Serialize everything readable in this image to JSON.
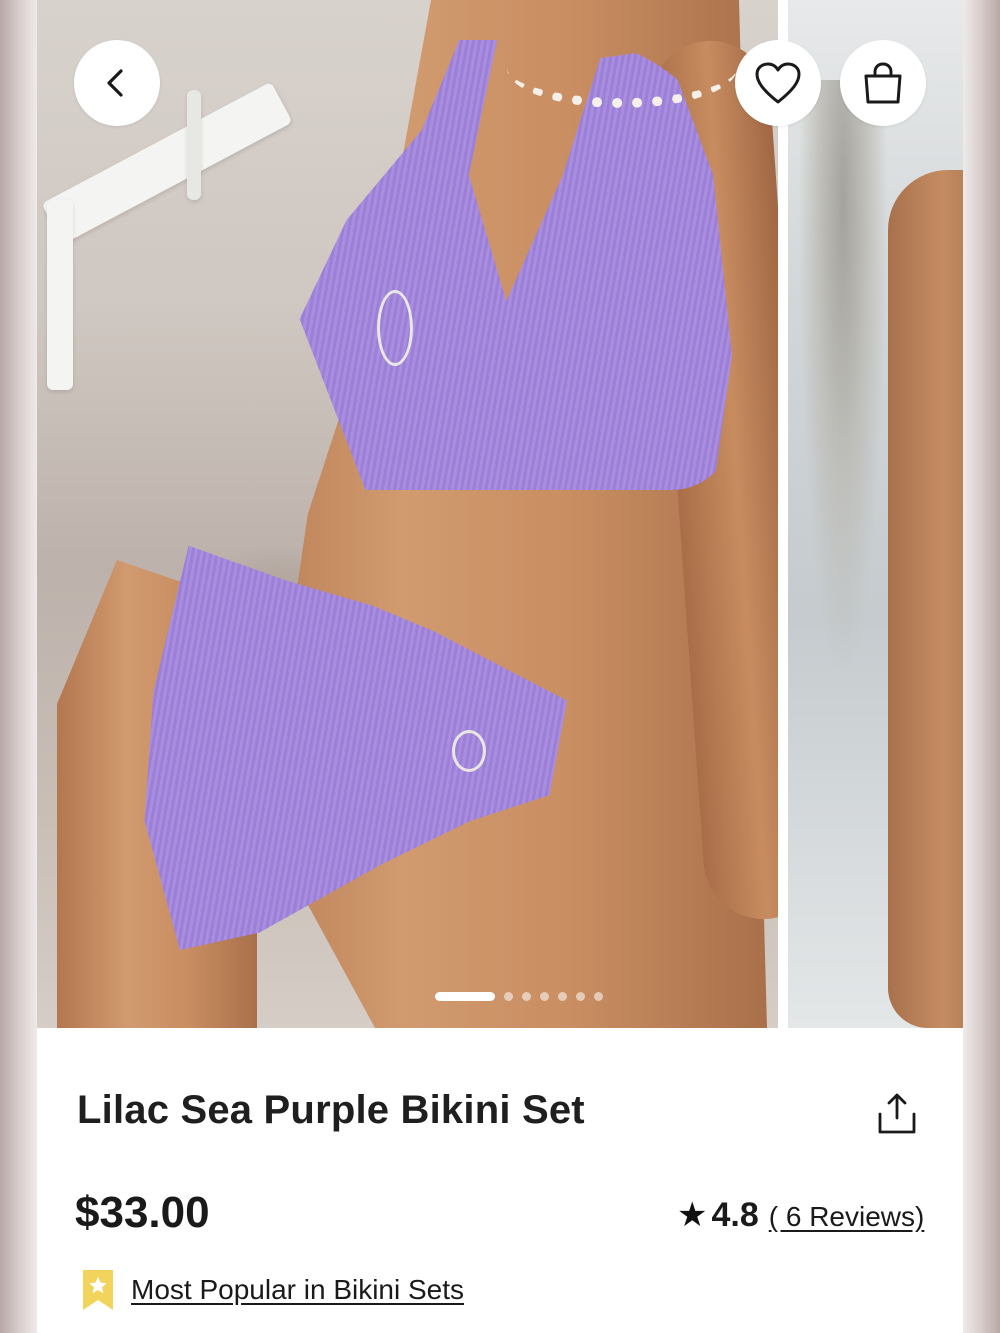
{
  "header": {
    "back_icon": "chevron-left-icon",
    "favorite_icon": "heart-outline-icon",
    "bag_icon": "shopping-bag-icon"
  },
  "gallery": {
    "image_count": 7,
    "active_index": 0
  },
  "product": {
    "title": "Lilac Sea Purple Bikini Set",
    "price": "$33.00",
    "rating_value": "4.8",
    "reviews_label": "( 6 Reviews)",
    "badge_label": "Most Popular in Bikini Sets",
    "share_icon": "share-icon"
  },
  "colors": {
    "text": "#1a1a1a",
    "badge": "#f2d45c",
    "swimsuit": "#a98ee0"
  }
}
